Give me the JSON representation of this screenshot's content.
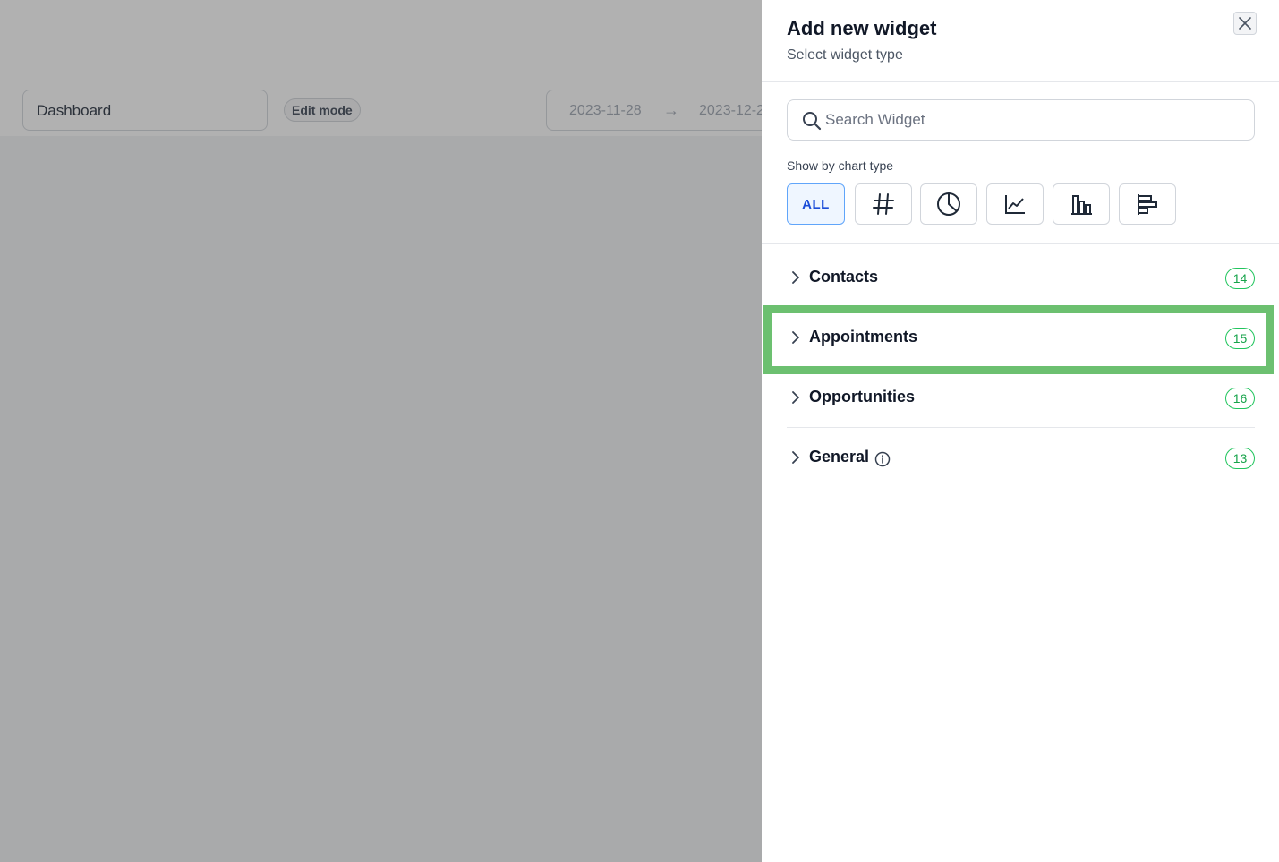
{
  "background": {
    "dashboard_select": "Dashboard",
    "edit_mode_label": "Edit mode",
    "date_start": "2023-11-28",
    "date_arrow": "→",
    "date_end": "2023-12-2"
  },
  "drawer": {
    "title": "Add new widget",
    "subtitle": "Select widget type",
    "search_placeholder": "Search Widget",
    "filter_label": "Show by chart type",
    "filters": [
      {
        "label": "ALL",
        "icon": "all-text"
      },
      {
        "icon": "hash-icon"
      },
      {
        "icon": "pie-chart-icon"
      },
      {
        "icon": "line-chart-icon"
      },
      {
        "icon": "bar-chart-icon"
      },
      {
        "icon": "horizontal-bar-chart-icon"
      }
    ],
    "categories": [
      {
        "label": "Contacts",
        "count": "14"
      },
      {
        "label": "Appointments",
        "count": "15"
      },
      {
        "label": "Opportunities",
        "count": "16"
      },
      {
        "label": "General",
        "count": "13"
      }
    ]
  },
  "colors": {
    "highlight": "#6cc070",
    "badge": "#22c55e",
    "active_filter": "#1d4ed8"
  }
}
